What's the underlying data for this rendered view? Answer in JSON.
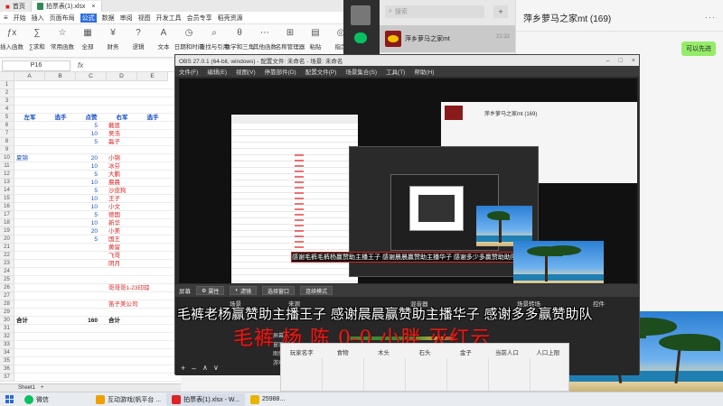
{
  "spreadsheet": {
    "tabs": [
      {
        "label": "首页"
      },
      {
        "label": "拍票表(1).xlsx"
      }
    ],
    "menu": [
      "开始",
      "插入",
      "页面布局",
      "公式",
      "数据",
      "审阅",
      "视图",
      "开发工具",
      "会员专享",
      "稻壳资源"
    ],
    "menu_highlight": "公式",
    "ribbon": [
      "插入函数",
      "∑求和",
      "常用函数",
      "全部",
      "财务",
      "逻辑",
      "文本",
      "日期和时间",
      "查找与引用",
      "数学和三角",
      "其他函数",
      "名称管理器",
      "粘贴",
      "指定",
      "追踪引用"
    ],
    "cell_ref": "P16",
    "fx": "fx",
    "columns": [
      "A",
      "B",
      "C",
      "D",
      "E"
    ],
    "header_row": {
      "row": 5,
      "a": "左军",
      "b": "选手",
      "c": "点赞",
      "d": "右军",
      "e": "选手"
    },
    "rows": [
      {
        "n": 6,
        "c": "5",
        "d": "戴恩"
      },
      {
        "n": 7,
        "c": "10",
        "d": "吴浩"
      },
      {
        "n": 8,
        "c": "5",
        "d": "磊子"
      },
      {
        "n": 9
      },
      {
        "n": 10,
        "a": "夏锦",
        "c": "20",
        "d": "小锦"
      },
      {
        "n": 11,
        "c": "10",
        "d": "冰芬"
      },
      {
        "n": 12,
        "c": "5",
        "d": "大鹏"
      },
      {
        "n": 13,
        "c": "10",
        "d": "晨晨"
      },
      {
        "n": 14,
        "c": "5",
        "d": "沙皮狗"
      },
      {
        "n": 15,
        "c": "10",
        "d": "王子"
      },
      {
        "n": 16,
        "c": "10",
        "d": "小文"
      },
      {
        "n": 17,
        "c": "5",
        "d": "德国"
      },
      {
        "n": 18,
        "c": "10",
        "d": "新华"
      },
      {
        "n": 19,
        "c": "20",
        "d": "小美"
      },
      {
        "n": 20,
        "c": "5",
        "d": "国王"
      },
      {
        "n": 21,
        "d": "黄留"
      },
      {
        "n": 22,
        "d": "飞哥"
      },
      {
        "n": 23,
        "d": "阴月"
      },
      {
        "n": 24
      },
      {
        "n": 25
      },
      {
        "n": 26,
        "d": "哥哥哥1-23印琼"
      },
      {
        "n": 27
      },
      {
        "n": 28,
        "d": "笛子美公司"
      },
      {
        "n": 29
      },
      {
        "n": 30,
        "a": "合计",
        "c": "160",
        "d": "合计"
      }
    ],
    "more_rows": [
      31,
      32,
      33,
      34,
      35,
      36,
      37,
      38,
      39,
      40,
      41
    ],
    "sheet_tab": "Sheet1"
  },
  "chat": {
    "search_placeholder": "搜索",
    "conversation": {
      "name": "萍乡萝马之家mt",
      "time": "21:32"
    },
    "title": "萍乡萝马之家mt (169)",
    "more": "···",
    "bubble": "可以先进"
  },
  "obs": {
    "title": "OBS 27.0.1 (64-bit, windows) - 配置文件: 未命名 - 场景: 未命名",
    "menu": [
      "文件(F)",
      "编辑(E)",
      "视图(V)",
      "停靠部件(D)",
      "配置文件(P)",
      "场景集合(S)",
      "工具(T)",
      "帮助(H)"
    ],
    "toolbar": {
      "label": "屏幕",
      "properties": "属性",
      "filters": "滤镜",
      "select_window": "选择窗口",
      "mode": "连续模式"
    },
    "ticker": "感谢毛裤毛裤杨赢赞助主播王子 感谢晨晨赢赞助主播华子 感谢多少多赢赞助助队友王子",
    "docks": {
      "scenes": "场景",
      "sources": "来源",
      "mixer": "混音器",
      "transitions": "场景转场",
      "controls": "控件"
    },
    "sources_list": [
      "屏幕",
      "窗口捕获",
      "图像",
      "游戏源"
    ]
  },
  "overlay": {
    "line1": "毛裤老杨赢赞助主播王子 感谢晨晨赢赞助主播华子 感谢多多赢赞助队",
    "line2": "毛裤 杨 陈 0-0 小胖 灭红云"
  },
  "table_overlay": {
    "headers": [
      "玩家名字",
      "食物",
      "木头",
      "石头",
      "金子",
      "当前人口",
      "人口上限"
    ]
  },
  "taskbar": {
    "items": [
      {
        "label": "微信"
      },
      {
        "label": "互动游戏(帆平台 ..."
      },
      {
        "label": "拍票表(1).xlsx - W..."
      },
      {
        "label": "25988..."
      }
    ]
  }
}
